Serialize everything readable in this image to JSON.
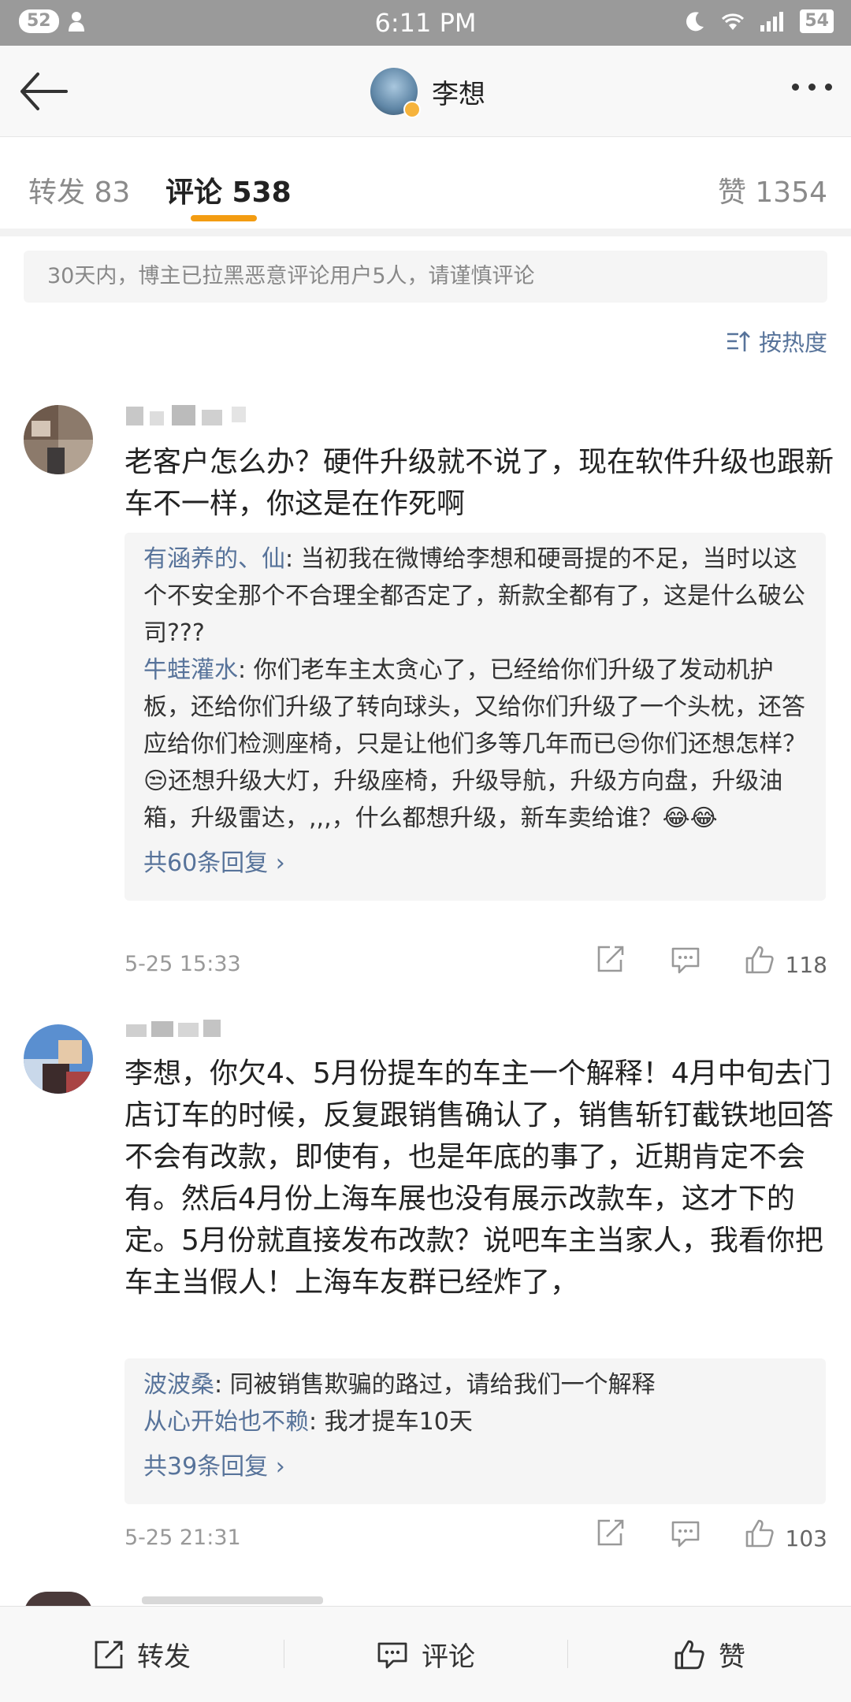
{
  "status_bar": {
    "notifications": "52",
    "time": "6:11 PM",
    "battery": "54"
  },
  "header": {
    "title": "李想"
  },
  "tabs": [
    {
      "label": "转发 83"
    },
    {
      "label": "评论 538"
    },
    {
      "label": "赞 1354"
    }
  ],
  "notice": "30天内，博主已拉黑恶意评论用户5人，请谨慎评论",
  "sort": {
    "label": "按热度"
  },
  "comments": [
    {
      "text": "老客户怎么办？硬件升级就不说了，现在软件升级也跟新车不一样，你这是在作死啊",
      "replies": [
        {
          "name": "有涵养的、仙",
          "text": "当初我在微博给李想和硬哥提的不足，当时以这个不安全那个不合理全都否定了，新款全都有了，这是什么破公司???"
        },
        {
          "name": "牛蛙灌水",
          "text": "你们老车主太贪心了，已经给你们升级了发动机护板，还给你们升级了转向球头，又给你们升级了一个头枕，还答应给你们检测座椅，只是让他们多等几年而已😒你们还想怎样？😒还想升级大灯，升级座椅，升级导航，升级方向盘，升级油箱，升级雷达，,,,，什么都想升级，新车卖给谁？😂😂"
        }
      ],
      "more_replies": "共60条回复 ›",
      "date": "5-25 15:33",
      "likes": "118"
    },
    {
      "text": "李想，你欠4、5月份提车的车主一个解释！4月中旬去门店订车的时候，反复跟销售确认了，销售斩钉截铁地回答不会有改款，即使有，也是年底的事了，近期肯定不会有。然后4月份上海车展也没有展示改款车，这才下的定。5月份就直接发布改款？说吧车主当家人，我看你把车主当假人！上海车友群已经炸了，",
      "replies": [
        {
          "name": "波波桑",
          "text": "同被销售欺骗的路过，请给我们一个解释"
        },
        {
          "name": "从心开始也不赖",
          "text": "我才提车10天"
        }
      ],
      "more_replies": "共39条回复 ›",
      "date": "5-25 21:31",
      "likes": "103"
    }
  ],
  "bottom_bar": {
    "repost": "转发",
    "comment": "评论",
    "like": "赞"
  }
}
